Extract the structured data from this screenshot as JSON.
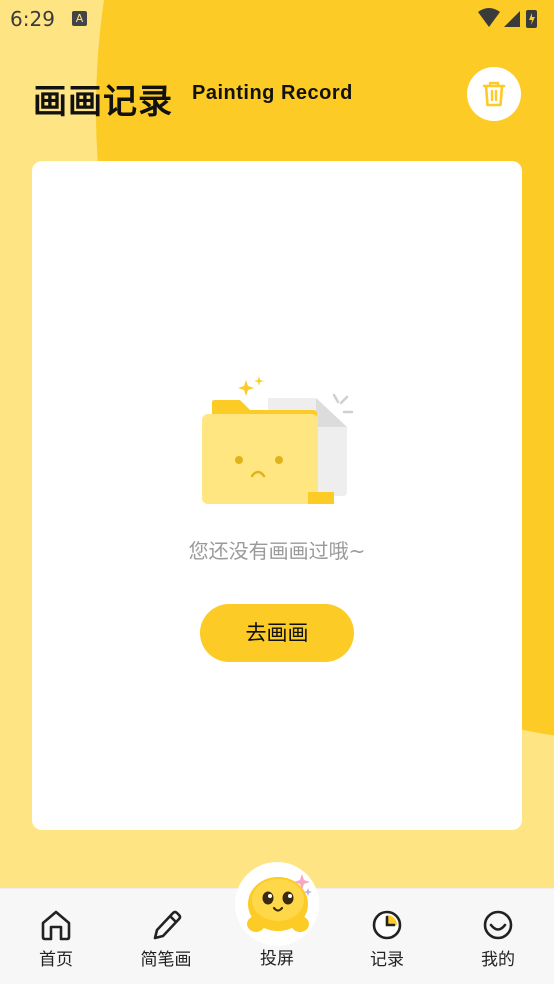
{
  "status": {
    "time": "6:29"
  },
  "header": {
    "title": "画画记录",
    "subtitle": "Painting Record"
  },
  "empty": {
    "message": "您还没有画画过哦~",
    "button_label": "去画画"
  },
  "tabs": [
    {
      "label": "首页",
      "icon": "home-icon"
    },
    {
      "label": "简笔画",
      "icon": "pencil-icon"
    },
    {
      "label": "投屏",
      "icon": "cast-mascot-icon"
    },
    {
      "label": "记录",
      "icon": "clock-icon"
    },
    {
      "label": "我的",
      "icon": "smile-icon"
    }
  ],
  "colors": {
    "accent": "#FCCB25",
    "background": "#FEE483"
  }
}
